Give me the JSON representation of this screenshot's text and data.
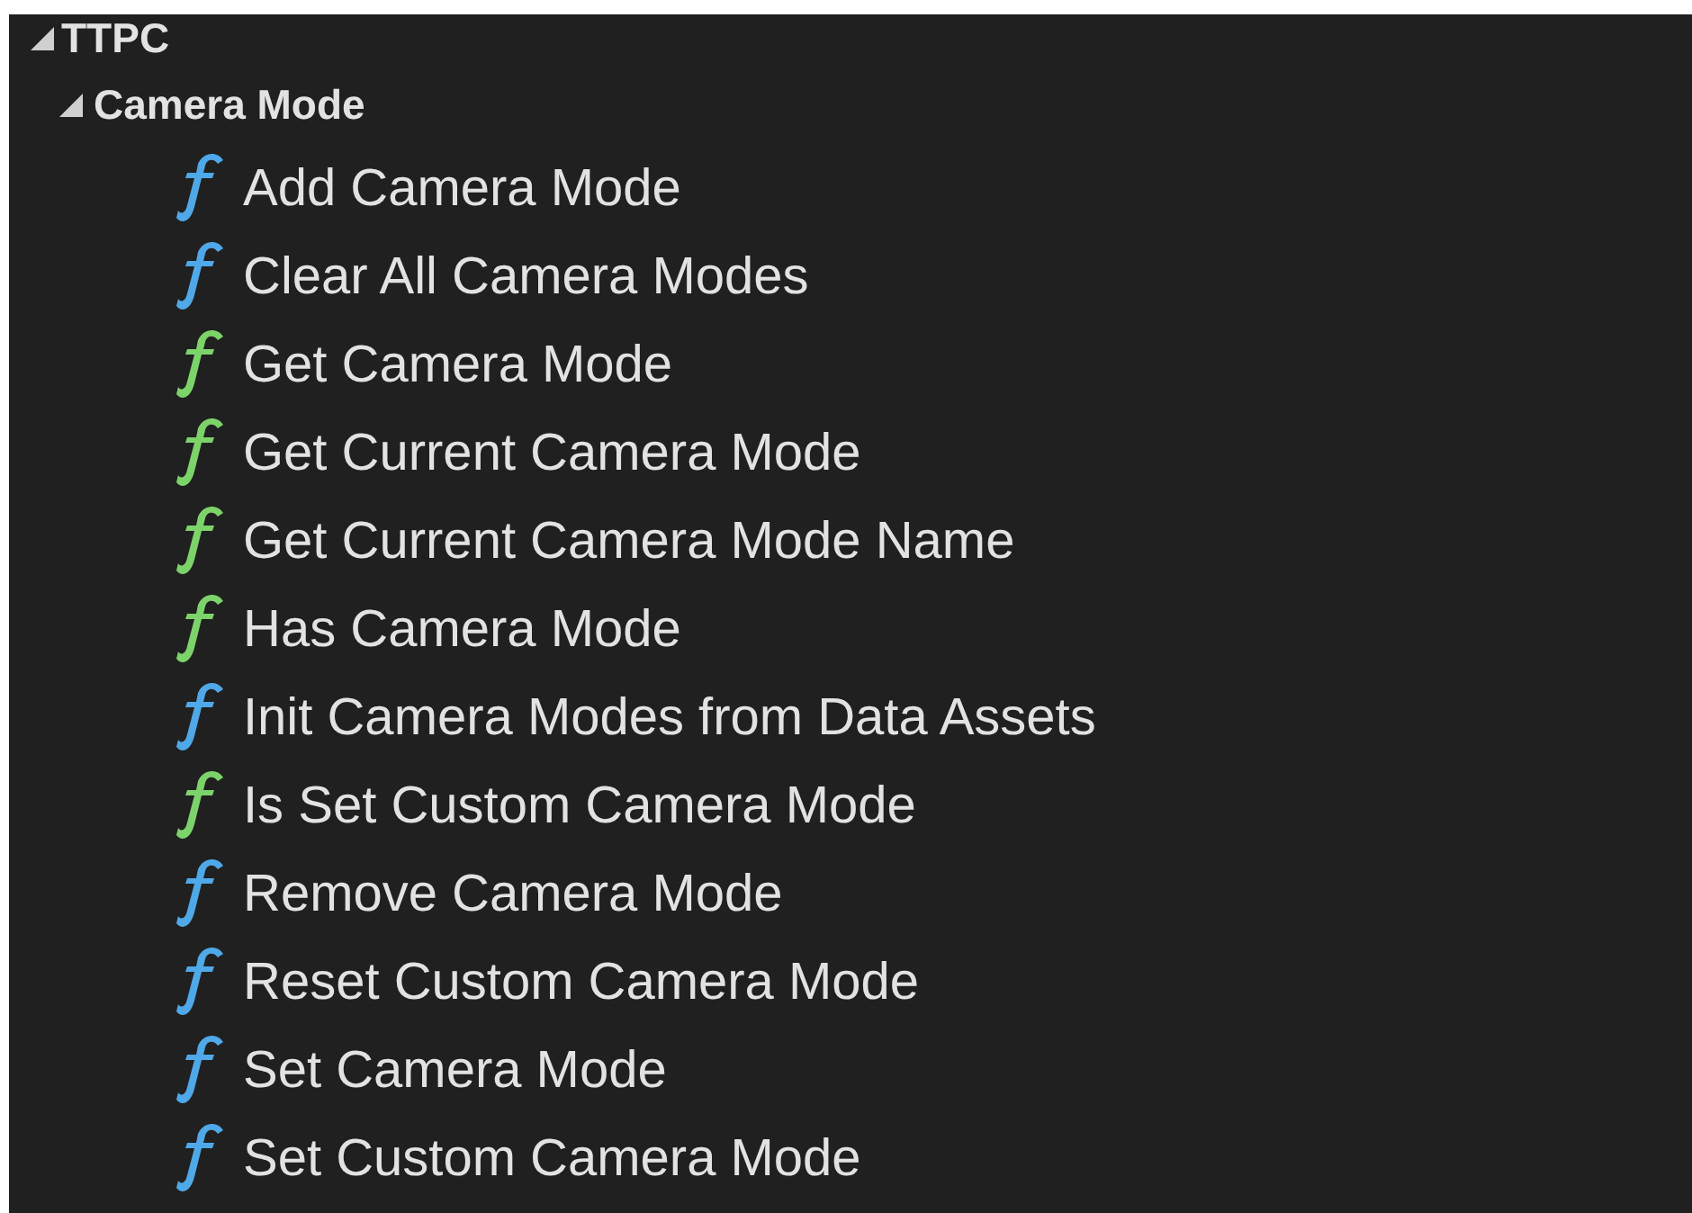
{
  "tree": [
    {
      "label": "TTPC",
      "expanded": true,
      "children": [
        {
          "label": "Camera Mode",
          "expanded": true,
          "children": [
            {
              "label": "Add Camera Mode",
              "color": "#4fa8e8"
            },
            {
              "label": "Clear All Camera Modes",
              "color": "#4fa8e8"
            },
            {
              "label": "Get Camera Mode",
              "color": "#7cd36a"
            },
            {
              "label": "Get Current Camera Mode",
              "color": "#7cd36a"
            },
            {
              "label": "Get Current Camera Mode Name",
              "color": "#7cd36a"
            },
            {
              "label": "Has Camera Mode",
              "color": "#7cd36a"
            },
            {
              "label": "Init Camera Modes from Data Assets",
              "color": "#4fa8e8"
            },
            {
              "label": "Is Set Custom Camera Mode",
              "color": "#7cd36a"
            },
            {
              "label": "Remove Camera Mode",
              "color": "#4fa8e8"
            },
            {
              "label": "Reset Custom Camera Mode",
              "color": "#4fa8e8"
            },
            {
              "label": "Set Camera Mode",
              "color": "#4fa8e8"
            },
            {
              "label": "Set Custom Camera Mode",
              "color": "#4fa8e8"
            }
          ]
        }
      ]
    }
  ]
}
